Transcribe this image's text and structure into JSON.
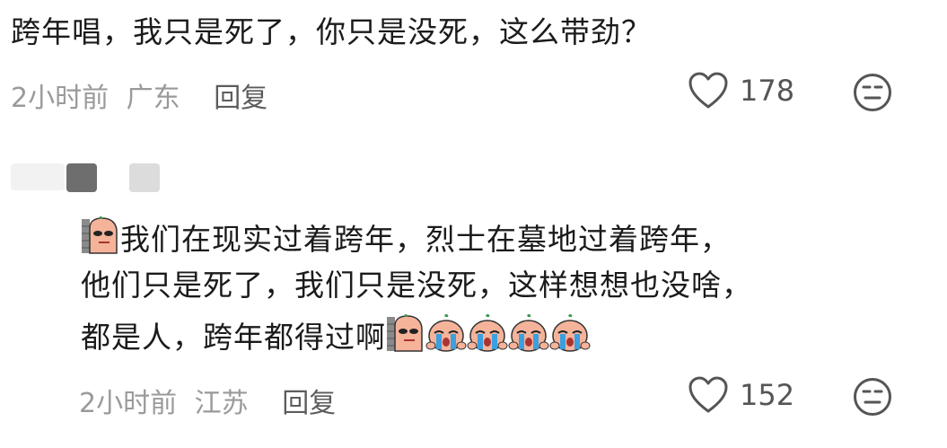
{
  "comment1": {
    "text": "跨年唱，我只是死了，你只是没死，这么带劲？",
    "time": "2小时前",
    "location": "广东",
    "reply_label": "回复",
    "like_count": "178"
  },
  "comment2": {
    "line1": "我们在现实过着跨年，烈士在墓地过着跨年，",
    "line2": "他们只是死了，我们只是没死，这样想想也没啥，",
    "line3": "都是人，跨年都得过啊",
    "time": "2小时前",
    "location": "江苏",
    "reply_label": "回复",
    "like_count": "152"
  },
  "icons": {
    "like": "heart-outline-icon",
    "react": "neutral-face-icon",
    "sticker_wall": "peeking-wall-sticker",
    "sticker_cry": "crying-face-sticker"
  },
  "colors": {
    "text": "#1b1b1b",
    "meta": "#9a9a9a",
    "icon": "#555555"
  }
}
